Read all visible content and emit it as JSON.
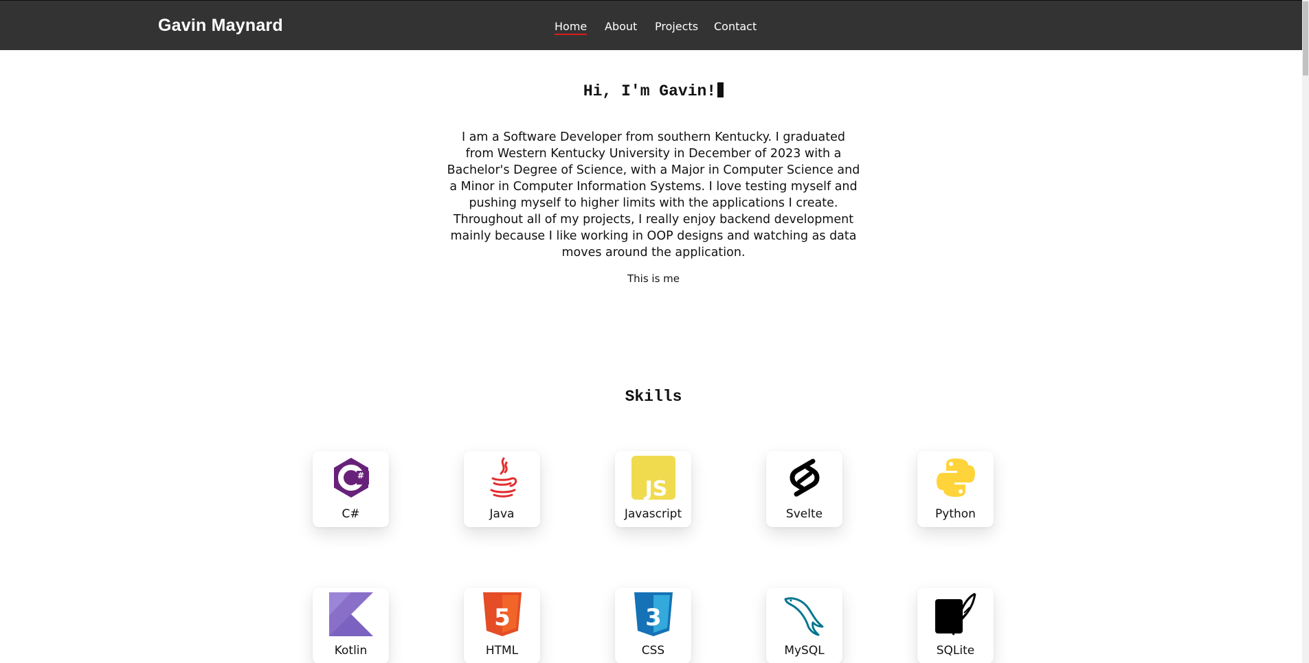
{
  "header": {
    "brand": "Gavin Maynard",
    "nav": [
      {
        "label": "Home",
        "active": true
      },
      {
        "label": "About",
        "active": false
      },
      {
        "label": "Projects",
        "active": false
      },
      {
        "label": "Contact",
        "active": false
      }
    ],
    "active_underline_color": "#e01b1b",
    "background_color": "#333333"
  },
  "hero": {
    "title": "Hi, I'm Gavin!",
    "bio": "I am a Software Developer from southern Kentucky. I graduated from Western Kentucky University in December of 2023 with a Bachelor's Degree of Science, with a Major in Computer Science and a Minor in Computer Information Systems. I love testing myself and pushing myself to higher limits with the applications I create. Throughout all of my projects, I really enjoy backend development mainly because I like working in OOP designs and watching as data moves around the application.",
    "photo_caption": "This is me"
  },
  "skills": {
    "title": "Skills",
    "items": [
      {
        "label": "C#",
        "icon": "csharp-icon",
        "color": "#68217a"
      },
      {
        "label": "Java",
        "icon": "java-icon",
        "color": "#e32c2e"
      },
      {
        "label": "Javascript",
        "icon": "javascript-icon",
        "color": "#f0db4f"
      },
      {
        "label": "Svelte",
        "icon": "svelte-icon",
        "color": "#000000"
      },
      {
        "label": "Python",
        "icon": "python-icon",
        "color": "#ffd43b"
      },
      {
        "label": "Kotlin",
        "icon": "kotlin-icon",
        "color": "#8a6fc9"
      },
      {
        "label": "HTML",
        "icon": "html5-icon",
        "color": "#e44d26"
      },
      {
        "label": "CSS",
        "icon": "css3-icon",
        "color": "#1572b6"
      },
      {
        "label": "MySQL",
        "icon": "mysql-icon",
        "color": "#00758f"
      },
      {
        "label": "SQLite",
        "icon": "sqlite-icon",
        "color": "#000000"
      }
    ]
  }
}
